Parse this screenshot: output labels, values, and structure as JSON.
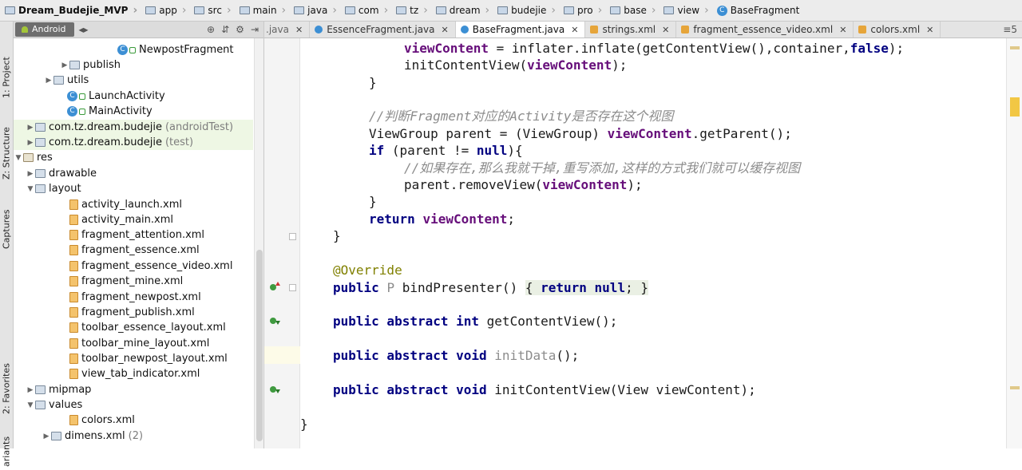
{
  "breadcrumb": [
    {
      "label": "Dream_Budejie_MVP"
    },
    {
      "label": "app"
    },
    {
      "label": "src"
    },
    {
      "label": "main"
    },
    {
      "label": "java"
    },
    {
      "label": "com"
    },
    {
      "label": "tz"
    },
    {
      "label": "dream"
    },
    {
      "label": "budejie"
    },
    {
      "label": "pro"
    },
    {
      "label": "base"
    },
    {
      "label": "view"
    },
    {
      "label": "BaseFragment"
    }
  ],
  "left_strip": {
    "project": "1: Project",
    "structure": "Z: Structure",
    "captures": "Captures",
    "favorites": "2: Favorites",
    "variants": "ariants"
  },
  "project_header": {
    "view_mode": "Android"
  },
  "tree": [
    {
      "label": "NewpostFragment",
      "type": "class"
    },
    {
      "label": "publish",
      "type": "folder",
      "arrow": "▶"
    },
    {
      "label": "utils",
      "type": "folder",
      "arrow": "▶"
    },
    {
      "label": "LaunchActivity",
      "type": "class"
    },
    {
      "label": "MainActivity",
      "type": "class"
    },
    {
      "label": "com.tz.dream.budejie",
      "suffix": "(androidTest)",
      "type": "folder",
      "arrow": "▶"
    },
    {
      "label": "com.tz.dream.budejie",
      "suffix": "(test)",
      "type": "folder",
      "arrow": "▶"
    },
    {
      "label": "res",
      "type": "res",
      "arrow": "▼"
    },
    {
      "label": "drawable",
      "type": "folder",
      "arrow": "▶"
    },
    {
      "label": "layout",
      "type": "folder",
      "arrow": "▼"
    },
    {
      "label": "activity_launch.xml",
      "type": "xml"
    },
    {
      "label": "activity_main.xml",
      "type": "xml"
    },
    {
      "label": "fragment_attention.xml",
      "type": "xml"
    },
    {
      "label": "fragment_essence.xml",
      "type": "xml"
    },
    {
      "label": "fragment_essence_video.xml",
      "type": "xml"
    },
    {
      "label": "fragment_mine.xml",
      "type": "xml"
    },
    {
      "label": "fragment_newpost.xml",
      "type": "xml"
    },
    {
      "label": "fragment_publish.xml",
      "type": "xml"
    },
    {
      "label": "toolbar_essence_layout.xml",
      "type": "xml"
    },
    {
      "label": "toolbar_mine_layout.xml",
      "type": "xml"
    },
    {
      "label": "toolbar_newpost_layout.xml",
      "type": "xml"
    },
    {
      "label": "view_tab_indicator.xml",
      "type": "xml"
    },
    {
      "label": "mipmap",
      "type": "folder",
      "arrow": "▶"
    },
    {
      "label": "values",
      "type": "folder",
      "arrow": "▼"
    },
    {
      "label": "colors.xml",
      "type": "xml"
    },
    {
      "label": "dimens.xml",
      "suffix": "(2)",
      "type": "folder",
      "arrow": "▶"
    }
  ],
  "tabs": [
    {
      "label": ".java",
      "partial": true
    },
    {
      "label": "EssenceFragment.java",
      "icon": "java"
    },
    {
      "label": "BaseFragment.java",
      "icon": "java",
      "active": true
    },
    {
      "label": "strings.xml",
      "icon": "xml"
    },
    {
      "label": "fragment_essence_video.xml",
      "icon": "xml"
    },
    {
      "label": "colors.xml",
      "icon": "xml"
    }
  ],
  "tab_overflow": "≡5",
  "code": {
    "l1_a": "viewContent",
    "l1_b": " = inflater.inflate(getContentView(),container,",
    "l1_c": "false",
    "l1_d": ");",
    "l2_a": "initContentView(",
    "l2_b": "viewContent",
    "l2_c": ");",
    "l3": "}",
    "l4": "//判断Fragment对应的Activity是否存在这个视图",
    "l5_a": "ViewGroup parent = (ViewGroup) ",
    "l5_b": "viewContent",
    "l5_c": ".getParent();",
    "l6_a": "if",
    "l6_b": " (parent != ",
    "l6_c": "null",
    "l6_d": "){",
    "l7": "//如果存在,那么我就干掉,重写添加,这样的方式我们就可以缓存视图",
    "l8_a": "parent.removeView(",
    "l8_b": "viewContent",
    "l8_c": ");",
    "l9": "}",
    "l10_a": "return ",
    "l10_b": "viewContent",
    "l10_c": ";",
    "l11": "}",
    "l12": "@Override",
    "l13_a": "public ",
    "l13_b": "P",
    "l13_c": " bindPresenter() ",
    "l13_d": "{ ",
    "l13_e": "return null",
    "l13_f": "; }",
    "l14_a": "public abstract int",
    "l14_b": " getContentView();",
    "l15_a": "public abstract void",
    "l15_b": " initData",
    "l15_c": "();",
    "l16_a": "public abstract void",
    "l16_b": " initContentView(View viewContent);",
    "l17": "}"
  }
}
